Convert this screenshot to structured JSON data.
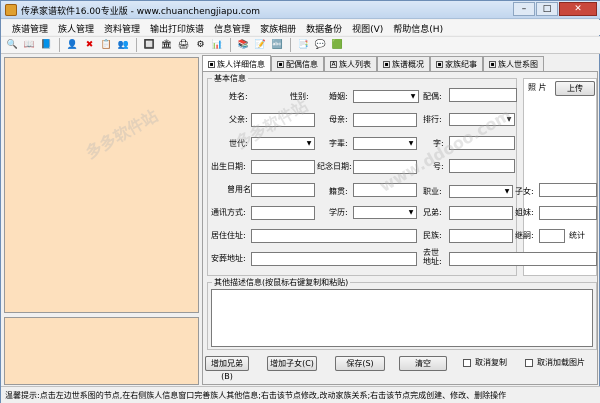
{
  "window": {
    "title": "传承家谱软件16.00专业版 - www.chuanchengjiapu.com",
    "min": "–",
    "max": "□",
    "close": "✕"
  },
  "menu": [
    "族谱管理",
    "族人管理",
    "资料管理",
    "输出打印族谱",
    "信息管理",
    "家族相册",
    "数据备份",
    "视图(V)",
    "帮助信息(H)"
  ],
  "toolbar": [
    "🔍",
    "📖",
    "📘",
    "👤",
    "✖",
    "📋",
    "👥",
    "🔲",
    "🏛",
    "🖨",
    "⚙",
    "📊",
    "📚",
    "📝",
    "🔤",
    "📑",
    "💬",
    "🟩"
  ],
  "tabs": [
    "族人详细信息",
    "配偶信息",
    "族人列表",
    "族谱概况",
    "家族纪事",
    "族人世系图"
  ],
  "form": {
    "group_title": "基本信息",
    "name": "姓名:",
    "gender": "性别:",
    "marital": "婚姻:",
    "spouse": "配偶:",
    "father": "父亲:",
    "mother": "母亲:",
    "rank": "排行:",
    "generation": "世代:",
    "zibei": "字辈:",
    "zi": "字:",
    "birth": "出生日期:",
    "memorial": "纪念日期:",
    "hao": "号:",
    "former_name": "曾用名:",
    "origin": "籍贯:",
    "job": "职业:",
    "children": "子女:",
    "contact": "通讯方式:",
    "education": "学历:",
    "brothers": "兄弟:",
    "sisters": "姐妹:",
    "address": "居住住址:",
    "nation": "民族:",
    "successor": "继嗣:",
    "stats": "统计",
    "burial": "安葬地址:",
    "death_place": "去世地址:",
    "photo": "照 片",
    "upload": "上传",
    "desc_title": "其他描述信息(按鼠标右键复制和粘贴)"
  },
  "buttons": {
    "add_brother": "增加兄弟(B)",
    "add_child": "增加子女(C)",
    "save": "保存(S)",
    "clear": "清空",
    "cancel_copy": "取消复制",
    "cancel_photo": "取消加载图片"
  },
  "status": "温馨提示:点击左边世系图的节点,在右侧族人信息窗口完善族人其他信息;右击该节点修改,改动家族关系;右击该节点完成创建、修改、删除操作",
  "watermarks": [
    "多多软件站",
    "www.ddooo.com",
    "多多软件站",
    "chuanchengjiapu",
    "多多软件站"
  ]
}
